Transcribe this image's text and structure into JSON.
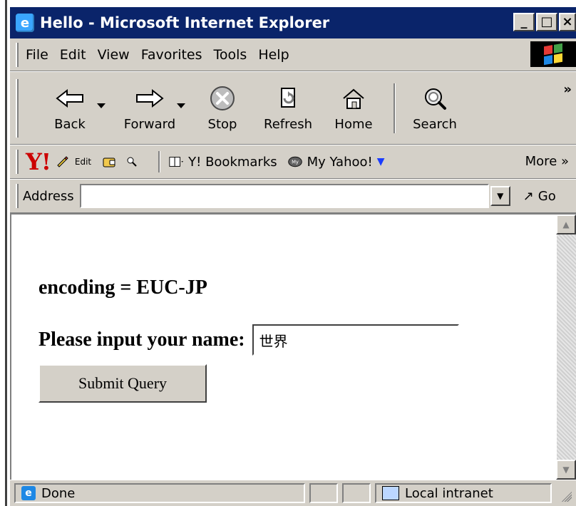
{
  "window": {
    "title": "Hello - Microsoft Internet Explorer"
  },
  "menubar": {
    "items": [
      "File",
      "Edit",
      "View",
      "Favorites",
      "Tools",
      "Help"
    ]
  },
  "toolbar": {
    "buttons": [
      {
        "label": "Back",
        "icon": "back-arrow-icon"
      },
      {
        "label": "Forward",
        "icon": "forward-arrow-icon"
      },
      {
        "label": "Stop",
        "icon": "stop-icon"
      },
      {
        "label": "Refresh",
        "icon": "refresh-icon"
      },
      {
        "label": "Home",
        "icon": "home-icon"
      },
      {
        "label": "Search",
        "icon": "search-icon"
      }
    ],
    "overflow": "»"
  },
  "linksbar": {
    "yahoo_logo": "Y!",
    "edit_label": "Edit",
    "bookmarks_label": "Y! Bookmarks",
    "my_yahoo_label": "My Yahoo!",
    "more_label": "More »"
  },
  "addressbar": {
    "label": "Address",
    "value": "",
    "go_label": "Go"
  },
  "page": {
    "encoding_line": "encoding = EUC-JP",
    "prompt": "Please input your name:",
    "name_value": "世界",
    "submit_label": "Submit Query"
  },
  "statusbar": {
    "status_text": "Done",
    "zone_text": "Local intranet"
  },
  "colors": {
    "title_bar": "#0a246a",
    "chrome": "#d4d0c8",
    "yahoo_red": "#cc0000"
  }
}
